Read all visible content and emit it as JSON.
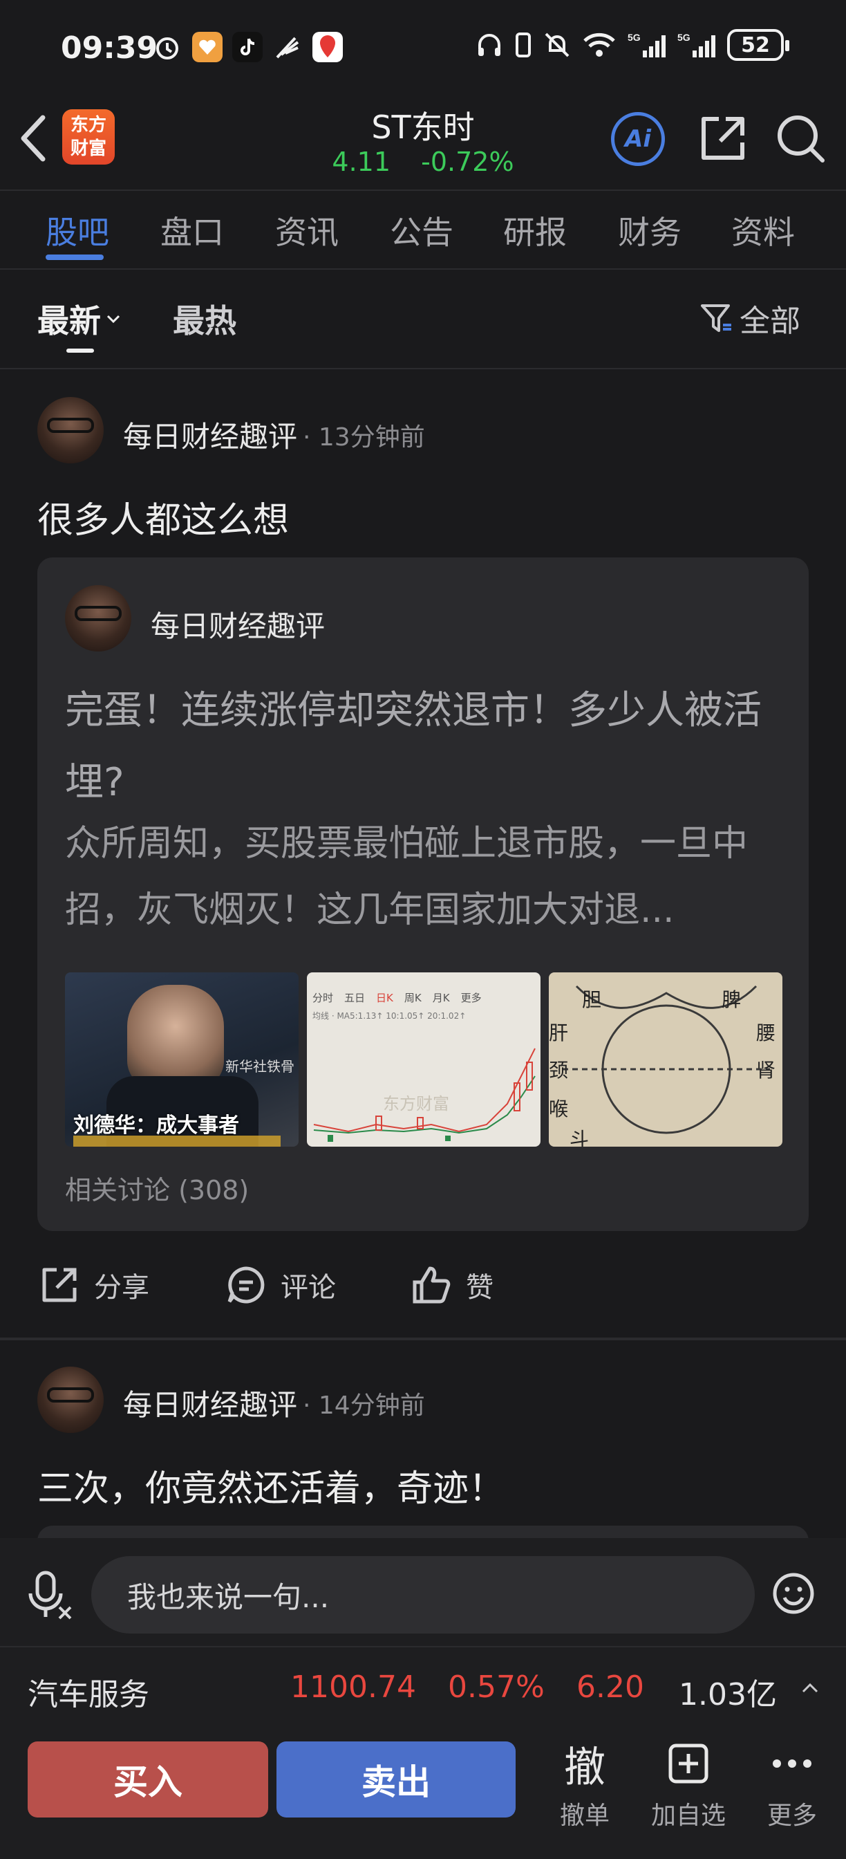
{
  "status_bar": {
    "time": "09:39",
    "battery": "52",
    "network": "5G"
  },
  "header": {
    "logo_text_line1": "东方",
    "logo_text_line2": "财富",
    "stock_name": "ST东时",
    "price": "4.11",
    "change_pct": "-0.72%",
    "ai_label": "Ai"
  },
  "tabs": [
    {
      "label": "股吧",
      "active": true
    },
    {
      "label": "盘口"
    },
    {
      "label": "资讯"
    },
    {
      "label": "公告"
    },
    {
      "label": "研报"
    },
    {
      "label": "财务"
    },
    {
      "label": "资料"
    }
  ],
  "filters": {
    "latest": "最新",
    "hot": "最热",
    "all": "全部"
  },
  "posts": [
    {
      "author": "每日财经趣评",
      "time": "· 13分钟前",
      "text": "很多人都这么想",
      "card": {
        "author": "每日财经趣评",
        "title": "完蛋！连续涨停却突然退市！多少人被活埋?",
        "summary": "众所周知，买股票最怕碰上退市股，一旦中招，灰飞烟灭！这几年国家加大对退...",
        "thumb1_caption": "刘德华：成大事者",
        "thumb1_watermark": "新华社铁骨",
        "thumb2_tabs": [
          "分时",
          "五日",
          "日K",
          "周K",
          "月K",
          "更多"
        ],
        "thumb2_ma": "均线 · MA5:1.13↑ 10:1.05↑ 20:1.02↑",
        "thumb2_watermark": "东方财富",
        "thumb3_labels": [
          "胆",
          "脾",
          "肝",
          "肾",
          "腰",
          "颈",
          "喉",
          "斗"
        ],
        "related": "相关讨论 (308)"
      },
      "actions": {
        "share": "分享",
        "comment": "评论",
        "like": "赞"
      }
    },
    {
      "author": "每日财经趣评",
      "time": "· 14分钟前",
      "text": "三次，你竟然还活着，奇迹！"
    }
  ],
  "input": {
    "placeholder": "我也来说一句..."
  },
  "industry": {
    "name": "汽车服务",
    "index": "1100.74",
    "change_pct": "0.57%",
    "change": "6.20",
    "amount": "1.03亿"
  },
  "trade": {
    "buy": "买入",
    "sell": "卖出",
    "cancel_icon": "撤",
    "cancel": "撤单",
    "add_watch": "加自选",
    "more": "更多"
  },
  "colors": {
    "accent": "#4a7ee0",
    "up_red": "#e9473f",
    "down_green": "#3ccb5a",
    "buy": "#b8504b",
    "sell": "#4b6fc9"
  }
}
